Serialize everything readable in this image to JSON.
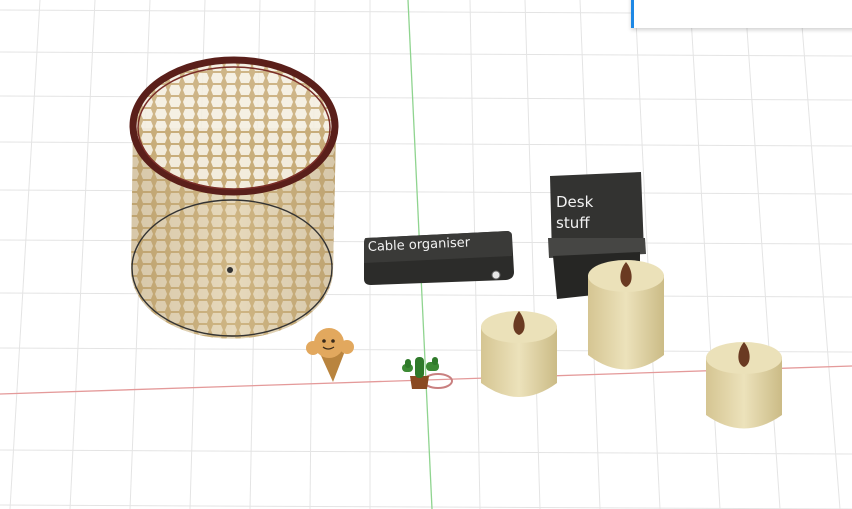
{
  "scene": {
    "labels": {
      "cable_organiser": "Cable organiser",
      "desk_line1": "Desk",
      "desk_line2": "stuff"
    },
    "colors": {
      "grid": "#e3e3e3",
      "x_axis": "#e08a8a",
      "y_axis": "#8fd18f",
      "basket_rim": "#5a1f1a",
      "basket_mesh": "#c8ad7a",
      "box_dark": "#2e2e2c",
      "cylinder": "#e2d6a8",
      "bulb": "#6a3a22"
    },
    "icons": [
      "hex-basket-model",
      "cable-organiser-model",
      "desk-stuff-model",
      "ice-cream-figure-model",
      "cactus-model",
      "bulb-pot-model"
    ]
  }
}
